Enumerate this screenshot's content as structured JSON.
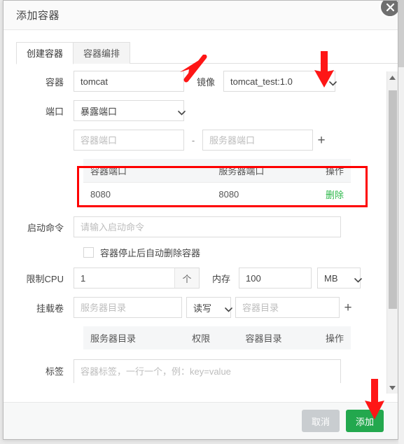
{
  "window": {
    "title": "添加容器",
    "close_icon": "close-icon"
  },
  "tabs": [
    {
      "label": "创建容器",
      "active": true
    },
    {
      "label": "容器编排",
      "active": false
    }
  ],
  "form": {
    "container": {
      "label": "容器",
      "value": "tomcat",
      "placeholder": ""
    },
    "image": {
      "label": "镜像",
      "value": "tomcat_test:1.0"
    },
    "port": {
      "label": "端口",
      "mode_value": "暴露端口",
      "container_port_placeholder": "容器端口",
      "server_port_placeholder": "服务器端口",
      "separator": "-",
      "add_icon": "+",
      "table": {
        "headers": [
          "容器端口",
          "服务器端口",
          "操作"
        ],
        "rows": [
          {
            "container_port": "8080",
            "server_port": "8080",
            "action": "删除"
          }
        ]
      }
    },
    "start_command": {
      "label": "启动命令",
      "placeholder": "请输入启动命令",
      "value": ""
    },
    "auto_remove": {
      "label": "容器停止后自动删除容器",
      "checked": false
    },
    "cpu": {
      "label": "限制CPU",
      "value": "1",
      "unit": "个"
    },
    "memory": {
      "label": "内存",
      "value": "100",
      "unit": "MB"
    },
    "volume": {
      "label": "挂载卷",
      "server_dir_placeholder": "服务器目录",
      "mode_value": "读写",
      "container_dir_placeholder": "容器目录",
      "add_icon": "+",
      "table": {
        "headers": [
          "服务器目录",
          "权限",
          "容器目录",
          "操作"
        ],
        "rows": []
      }
    },
    "labels": {
      "label": "标签",
      "placeholder": "容器标签，一行一个，例：key=value",
      "value": ""
    }
  },
  "footer": {
    "cancel_label": "取消",
    "submit_label": "添加"
  },
  "colors": {
    "accent_green": "#23a84e",
    "delete_link": "#2eb84b",
    "cancel_gray": "#c9cdd0",
    "annotation_red": "#fe0000"
  },
  "annotations": {
    "arrow_container_name": "red-arrow-icon",
    "arrow_image_select": "red-arrow-icon",
    "arrow_submit_button": "red-arrow-icon",
    "highlight_port_table": "red-highlight-rect"
  }
}
